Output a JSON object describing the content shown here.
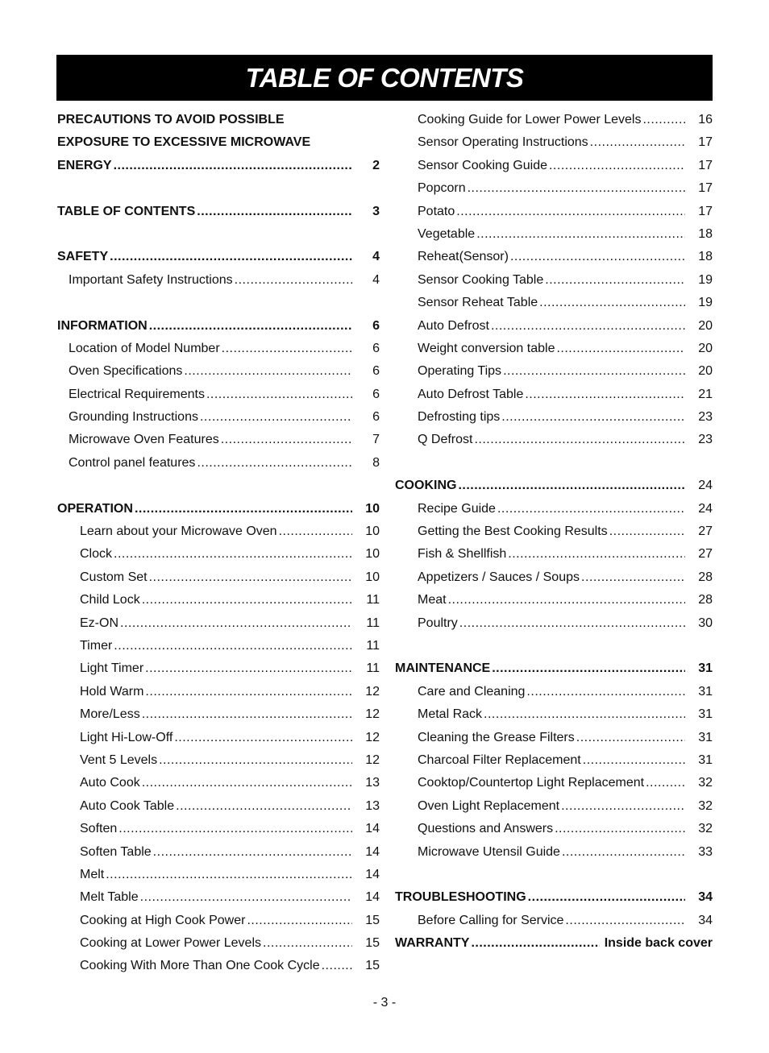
{
  "title": "TABLE OF CONTENTS",
  "left": [
    {
      "text": "PRECAUTIONS TO AVOID POSSIBLE",
      "level": 0,
      "page": "",
      "plain": true
    },
    {
      "text": "EXPOSURE TO EXCESSIVE MICROWAVE",
      "level": 0,
      "page": "",
      "plain": true
    },
    {
      "text": "ENERGY",
      "level": 0,
      "page": "2"
    },
    {
      "gap": true
    },
    {
      "text": "TABLE OF CONTENTS",
      "level": 0,
      "page": "3"
    },
    {
      "gap": true
    },
    {
      "text": "SAFETY",
      "level": 0,
      "page": "4"
    },
    {
      "text": "Important Safety Instructions",
      "level": 1,
      "page": "4"
    },
    {
      "gap": true
    },
    {
      "text": "INFORMATION",
      "level": 0,
      "page": "6"
    },
    {
      "text": "Location of Model Number",
      "level": 1,
      "page": "6"
    },
    {
      "text": "Oven Specifications",
      "level": 1,
      "page": "6"
    },
    {
      "text": "Electrical Requirements",
      "level": 1,
      "page": "6"
    },
    {
      "text": "Grounding Instructions",
      "level": 1,
      "page": "6"
    },
    {
      "text": "Microwave Oven Features",
      "level": 1,
      "page": "7"
    },
    {
      "text": "Control panel features",
      "level": 1,
      "page": "8"
    },
    {
      "gap": true
    },
    {
      "text": "OPERATION",
      "level": 0,
      "page": "10"
    },
    {
      "text": "Learn about your Microwave Oven",
      "level": 2,
      "page": "10"
    },
    {
      "text": "Clock",
      "level": 2,
      "page": "10"
    },
    {
      "text": "Custom Set",
      "level": 2,
      "page": "10"
    },
    {
      "text": "Child Lock",
      "level": 2,
      "page": "11"
    },
    {
      "text": "Ez-ON",
      "level": 2,
      "page": "11"
    },
    {
      "text": "Timer",
      "level": 2,
      "page": "11"
    },
    {
      "text": "Light Timer",
      "level": 2,
      "page": "11"
    },
    {
      "text": "Hold Warm",
      "level": 2,
      "page": "12"
    },
    {
      "text": "More/Less",
      "level": 2,
      "page": "12"
    },
    {
      "text": "Light Hi-Low-Off",
      "level": 2,
      "page": "12"
    },
    {
      "text": "Vent 5 Levels",
      "level": 2,
      "page": "12"
    },
    {
      "text": "Auto Cook",
      "level": 2,
      "page": "13"
    },
    {
      "text": "Auto Cook Table",
      "level": 2,
      "page": "13"
    },
    {
      "text": "Soften",
      "level": 2,
      "page": "14"
    },
    {
      "text": "Soften Table",
      "level": 2,
      "page": "14"
    },
    {
      "text": "Melt",
      "level": 2,
      "page": "14"
    },
    {
      "text": "Melt Table",
      "level": 2,
      "page": "14"
    },
    {
      "text": "Cooking at High Cook Power",
      "level": 2,
      "page": "15"
    },
    {
      "text": "Cooking at Lower Power Levels",
      "level": 2,
      "page": "15"
    },
    {
      "text": "Cooking With More Than One Cook Cycle",
      "level": 2,
      "page": "15"
    }
  ],
  "right": [
    {
      "text": "Cooking Guide for Lower Power Levels",
      "level": 2,
      "page": "16"
    },
    {
      "text": "Sensor Operating Instructions",
      "level": 2,
      "page": "17"
    },
    {
      "text": "Sensor Cooking Guide",
      "level": 2,
      "page": "17"
    },
    {
      "text": "Popcorn",
      "level": 2,
      "page": "17"
    },
    {
      "text": "Potato",
      "level": 2,
      "page": "17"
    },
    {
      "text": "Vegetable",
      "level": 2,
      "page": "18"
    },
    {
      "text": "Reheat(Sensor)",
      "level": 2,
      "page": "18"
    },
    {
      "text": "Sensor Cooking Table",
      "level": 2,
      "page": "19"
    },
    {
      "text": "Sensor Reheat Table",
      "level": 2,
      "page": "19"
    },
    {
      "text": "Auto Defrost",
      "level": 2,
      "page": "20"
    },
    {
      "text": "Weight conversion table",
      "level": 2,
      "page": "20"
    },
    {
      "text": "Operating Tips",
      "level": 2,
      "page": "20"
    },
    {
      "text": "Auto Defrost Table",
      "level": 2,
      "page": "21"
    },
    {
      "text": "Defrosting tips",
      "level": 2,
      "page": "23"
    },
    {
      "text": "Q Defrost",
      "level": 2,
      "page": "23"
    },
    {
      "gap": true
    },
    {
      "text": "COOKING",
      "level": 0,
      "page": "24",
      "pageNormal": true
    },
    {
      "text": "Recipe Guide",
      "level": 2,
      "page": "24"
    },
    {
      "text": "Getting the Best Cooking Results",
      "level": 2,
      "page": "27"
    },
    {
      "text": "Fish & Shellfish",
      "level": 2,
      "page": "27"
    },
    {
      "text": "Appetizers / Sauces / Soups",
      "level": 2,
      "page": "28"
    },
    {
      "text": "Meat",
      "level": 2,
      "page": "28"
    },
    {
      "text": "Poultry",
      "level": 2,
      "page": "30"
    },
    {
      "gap": true
    },
    {
      "text": "MAINTENANCE",
      "level": 0,
      "page": "31"
    },
    {
      "text": "Care and Cleaning",
      "level": 2,
      "page": "31"
    },
    {
      "text": "Metal Rack",
      "level": 2,
      "page": "31"
    },
    {
      "text": "Cleaning the Grease Filters",
      "level": 2,
      "page": "31"
    },
    {
      "text": "Charcoal Filter Replacement",
      "level": 2,
      "page": "31"
    },
    {
      "text": "Cooktop/Countertop Light Replacement",
      "level": 2,
      "page": "32"
    },
    {
      "text": "Oven Light Replacement",
      "level": 2,
      "page": "32"
    },
    {
      "text": "Questions and Answers",
      "level": 2,
      "page": "32"
    },
    {
      "text": "Microwave Utensil Guide",
      "level": 2,
      "page": "33"
    },
    {
      "gap": true
    },
    {
      "text": "TROUBLESHOOTING",
      "level": 0,
      "page": "34"
    },
    {
      "text": "Before Calling for Service",
      "level": 2,
      "page": "34"
    },
    {
      "text": "WARRANTY",
      "level": 0,
      "page": "Inside back cover",
      "wide": true
    }
  ],
  "footer": "- 3 -"
}
